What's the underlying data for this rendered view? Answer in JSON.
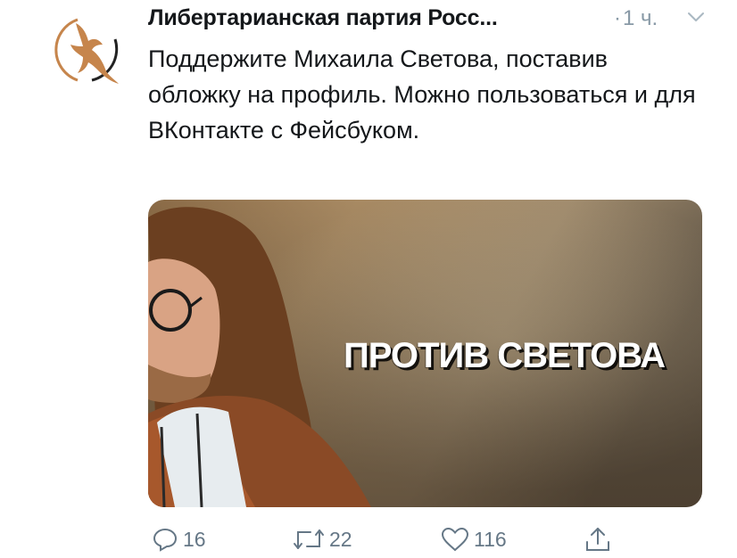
{
  "tweet": {
    "author": "Либертарианская партия Росс...",
    "separator": "·",
    "time": "1 ч.",
    "text": "Поддержите Михаила Светова, поставив обложку на профиль. Можно пользоваться и для ВКонтакте с Фейсбуком.",
    "avatar_icon": "eagle-logo-icon",
    "media": {
      "overlay_text": "ПРОТИВ СВЕТОВА"
    }
  },
  "actions": {
    "reply_count": "16",
    "retweet_count": "22",
    "like_count": "116"
  },
  "colors": {
    "text": "#14171a",
    "muted": "#657786",
    "brand_brown": "#c6854c"
  }
}
